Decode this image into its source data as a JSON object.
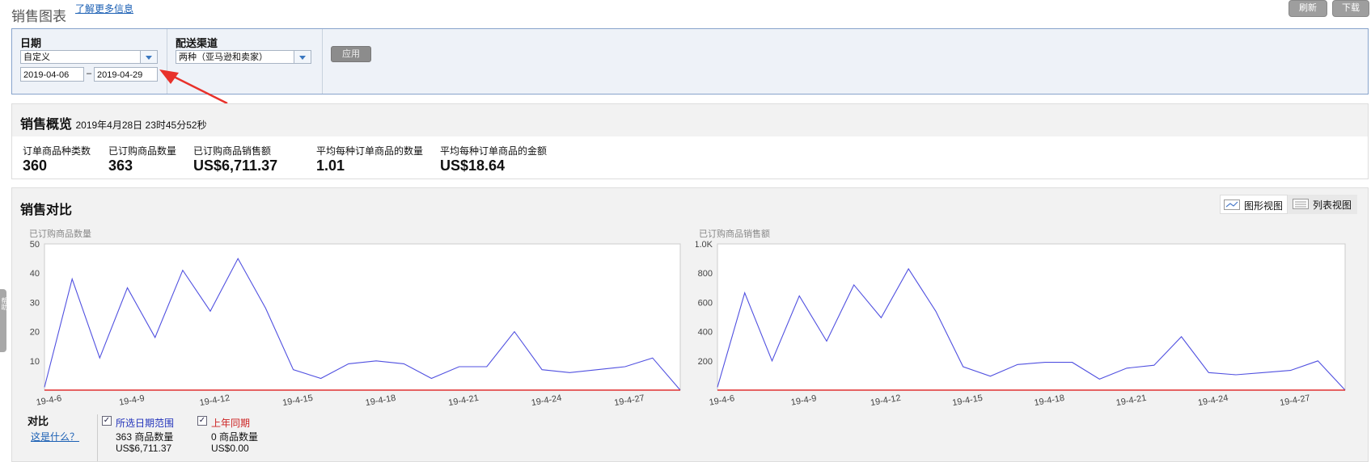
{
  "header": {
    "title": "销售图表",
    "learn_more": "了解更多信息",
    "refresh": "刷新",
    "download": "下载"
  },
  "filter": {
    "date_label": "日期",
    "date_range_option": "自定义",
    "date_from": "2019-04-06",
    "date_sep": "–",
    "date_to": "2019-04-29",
    "channel_label": "配送渠道",
    "channel_option": "两种（亚马逊和卖家）",
    "apply": "应用",
    "accent_color": "#e8312a"
  },
  "overview": {
    "title": "销售概览",
    "timestamp": "2019年4月28日 23时45分52秒",
    "metrics": [
      {
        "label": "订单商品种类数",
        "value": "360"
      },
      {
        "label": "已订购商品数量",
        "value": "363"
      },
      {
        "label": "已订购商品销售额",
        "value": "US$6,711.37"
      },
      {
        "label": "平均每种订单商品的数量",
        "value": "1.01"
      },
      {
        "label": "平均每种订单商品的金额",
        "value": "US$18.64"
      }
    ]
  },
  "compare": {
    "title": "销售对比",
    "graph_view": "图形视图",
    "list_view": "列表视图",
    "compare_label": "对比",
    "what_is_this": "这是什么？",
    "selected_range": {
      "label": "所选日期范围",
      "units": "363 商品数量",
      "sales": "US$6,711.37",
      "color": "#2233bb"
    },
    "last_year": {
      "label": "上年同期",
      "units": "0 商品数量",
      "sales": "US$0.00",
      "color": "#cc2222"
    },
    "side_tab": "帮助"
  },
  "chart_data": [
    {
      "type": "line",
      "title": "已订购商品数量",
      "x": [
        "19-4-6",
        "19-4-7",
        "19-4-8",
        "19-4-9",
        "19-4-10",
        "19-4-11",
        "19-4-12",
        "19-4-13",
        "19-4-14",
        "19-4-15",
        "19-4-16",
        "19-4-17",
        "19-4-18",
        "19-4-19",
        "19-4-20",
        "19-4-21",
        "19-4-22",
        "19-4-23",
        "19-4-24",
        "19-4-25",
        "19-4-26",
        "19-4-27",
        "19-4-28",
        "19-4-29"
      ],
      "xtick_labels": [
        "19-4-6",
        "19-4-9",
        "19-4-12",
        "19-4-15",
        "19-4-18",
        "19-4-21",
        "19-4-24",
        "19-4-27"
      ],
      "yticks": [
        "10",
        "20",
        "30",
        "40",
        "50"
      ],
      "ylim": [
        0,
        50
      ],
      "series": [
        {
          "name": "所选日期范围",
          "color": "#5050e0",
          "values": [
            1,
            38,
            11,
            35,
            18,
            41,
            27,
            45,
            28,
            7,
            4,
            9,
            10,
            9,
            4,
            8,
            8,
            20,
            7,
            6,
            7,
            8,
            11,
            0
          ]
        },
        {
          "name": "上年同期",
          "color": "#e03030",
          "values": [
            0,
            0,
            0,
            0,
            0,
            0,
            0,
            0,
            0,
            0,
            0,
            0,
            0,
            0,
            0,
            0,
            0,
            0,
            0,
            0,
            0,
            0,
            0,
            0
          ]
        }
      ]
    },
    {
      "type": "line",
      "title": "已订购商品销售额",
      "x": [
        "19-4-6",
        "19-4-7",
        "19-4-8",
        "19-4-9",
        "19-4-10",
        "19-4-11",
        "19-4-12",
        "19-4-13",
        "19-4-14",
        "19-4-15",
        "19-4-16",
        "19-4-17",
        "19-4-18",
        "19-4-19",
        "19-4-20",
        "19-4-21",
        "19-4-22",
        "19-4-23",
        "19-4-24",
        "19-4-25",
        "19-4-26",
        "19-4-27",
        "19-4-28",
        "19-4-29"
      ],
      "xtick_labels": [
        "19-4-6",
        "19-4-9",
        "19-4-12",
        "19-4-15",
        "19-4-18",
        "19-4-21",
        "19-4-24",
        "19-4-27"
      ],
      "yticks": [
        "200",
        "400",
        "600",
        "800",
        "1.0K"
      ],
      "ylim": [
        0,
        1000
      ],
      "series": [
        {
          "name": "所选日期范围",
          "color": "#5050e0",
          "values": [
            20,
            665,
            200,
            645,
            335,
            720,
            495,
            830,
            540,
            160,
            95,
            175,
            190,
            190,
            75,
            150,
            170,
            365,
            120,
            105,
            120,
            135,
            200,
            0
          ]
        },
        {
          "name": "上年同期",
          "color": "#e03030",
          "values": [
            0,
            0,
            0,
            0,
            0,
            0,
            0,
            0,
            0,
            0,
            0,
            0,
            0,
            0,
            0,
            0,
            0,
            0,
            0,
            0,
            0,
            0,
            0,
            0
          ]
        }
      ]
    }
  ]
}
